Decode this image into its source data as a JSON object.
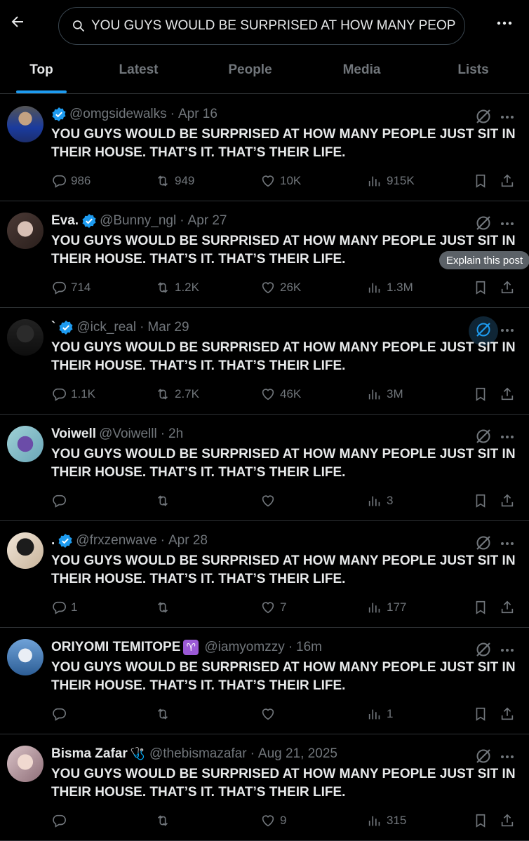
{
  "search": {
    "query": "YOU GUYS WOULD BE SURPRISED AT HOW MANY PEOPLE JUST SIT IN THEIR HOUSE. THAT'S IT. THAT'S THEIR LIFE."
  },
  "tabs": [
    "Top",
    "Latest",
    "People",
    "Media",
    "Lists"
  ],
  "tooltip": "Explain this post",
  "colors": {
    "accent": "#1d9bf0",
    "muted": "#71767b",
    "text": "#e7e9ea",
    "divider": "#2f3336"
  },
  "posts": [
    {
      "name": "",
      "verified": true,
      "handle": "@omgsidewalks",
      "time": "Apr 16",
      "text": "YOU GUYS WOULD BE SURPRISED AT HOW MANY PEOPLE JUST SIT IN THEIR HOUSE. THAT’S IT. THAT’S THEIR LIFE.",
      "replies": "986",
      "reposts": "949",
      "likes": "10K",
      "views": "915K"
    },
    {
      "name": "Eva.",
      "verified": true,
      "handle": "@Bunny_ngl",
      "time": "Apr 27",
      "text": "YOU GUYS WOULD BE SURPRISED AT HOW MANY PEOPLE JUST SIT IN THEIR HOUSE. THAT’S IT. THAT’S THEIR LIFE.",
      "replies": "714",
      "reposts": "1.2K",
      "likes": "26K",
      "views": "1.3M"
    },
    {
      "name": "`",
      "verified": true,
      "handle": "@ick_real",
      "time": "Mar 29",
      "text": "YOU GUYS WOULD BE SURPRISED AT HOW MANY PEOPLE JUST SIT IN THEIR HOUSE. THAT’S IT. THAT’S THEIR LIFE.",
      "replies": "1.1K",
      "reposts": "2.7K",
      "likes": "46K",
      "views": "3M"
    },
    {
      "name": "Voiwell",
      "verified": false,
      "handle": "@Voiwelll",
      "time": "2h",
      "text": "YOU GUYS WOULD BE SURPRISED AT HOW MANY PEOPLE JUST SIT IN THEIR HOUSE. THAT’S IT. THAT’S THEIR LIFE.",
      "replies": "",
      "reposts": "",
      "likes": "",
      "views": "3"
    },
    {
      "name": ".",
      "verified": true,
      "handle": "@frxzenwave",
      "time": "Apr 28",
      "text": "YOU GUYS WOULD BE SURPRISED AT HOW MANY PEOPLE JUST SIT IN THEIR HOUSE. THAT’S IT. THAT’S THEIR LIFE.",
      "replies": "1",
      "reposts": "",
      "likes": "7",
      "views": "177"
    },
    {
      "name": "ORIYOMI TEMITOPE",
      "emoji": "♈",
      "verified": false,
      "handle": "@iamyomzzy",
      "time": "16m",
      "text": "YOU GUYS WOULD BE SURPRISED AT HOW MANY PEOPLE JUST SIT IN THEIR HOUSE. THAT’S IT. THAT’S THEIR LIFE.",
      "replies": "",
      "reposts": "",
      "likes": "",
      "views": "1"
    },
    {
      "name": "Bisma Zafar",
      "emoji": "🩺",
      "verified": false,
      "handle": "@thebismazafar",
      "time": "Aug 21, 2025",
      "text": "YOU GUYS WOULD BE SURPRISED AT HOW MANY PEOPLE JUST SIT IN THEIR HOUSE. THAT’S IT. THAT’S THEIR LIFE.",
      "replies": "",
      "reposts": "",
      "likes": "9",
      "views": "315"
    }
  ]
}
